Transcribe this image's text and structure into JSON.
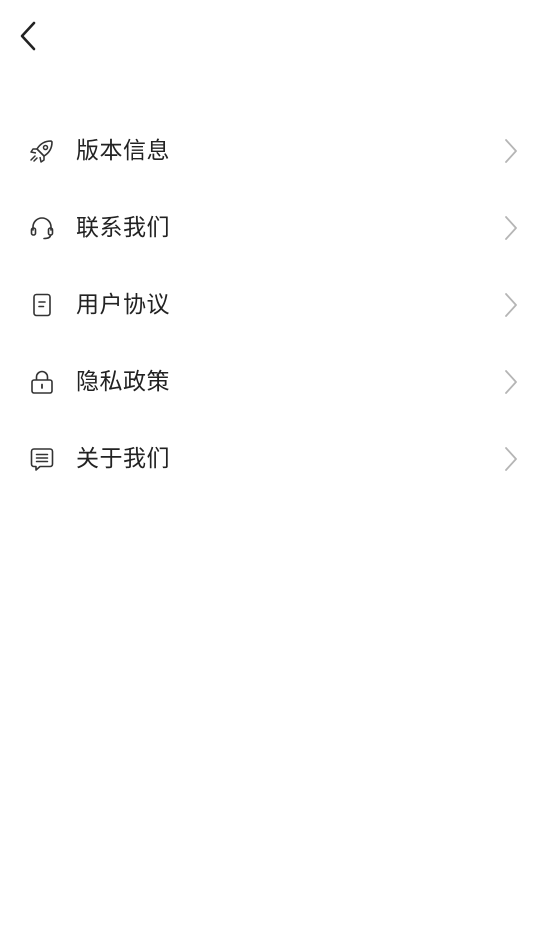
{
  "header": {
    "back_icon": "chevron-left-icon"
  },
  "menu": {
    "items": [
      {
        "key": "version",
        "label": "版本信息",
        "icon": "rocket-icon"
      },
      {
        "key": "contact",
        "label": "联系我们",
        "icon": "headset-icon"
      },
      {
        "key": "agreement",
        "label": "用户协议",
        "icon": "document-icon"
      },
      {
        "key": "privacy",
        "label": "隐私政策",
        "icon": "lock-icon"
      },
      {
        "key": "about",
        "label": "关于我们",
        "icon": "message-icon"
      }
    ]
  },
  "colors": {
    "text": "#222222",
    "icon": "#333333",
    "chevron": "#b5b5b5",
    "background": "#ffffff"
  }
}
